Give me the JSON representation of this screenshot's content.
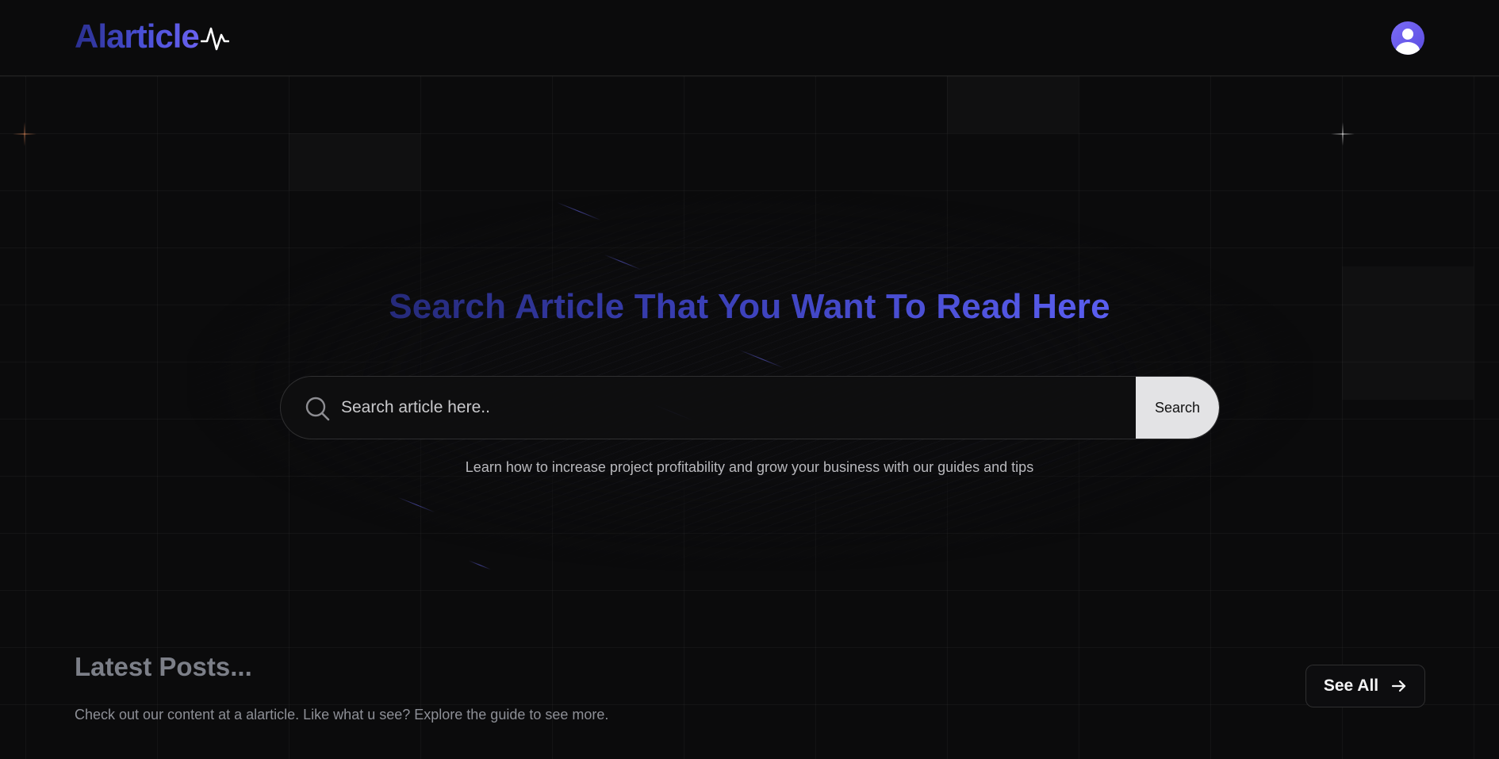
{
  "header": {
    "logo_text": "Alarticle",
    "logo_icon": "pulse-icon",
    "avatar_icon": "user-avatar-icon"
  },
  "hero": {
    "title": "Search Article That You Want To Read Here",
    "search": {
      "placeholder": "Search article here..",
      "value": "",
      "button_label": "Search",
      "icon": "search-icon"
    },
    "subtitle": "Learn how to increase project profitability and grow your business with our guides and tips"
  },
  "latest": {
    "title": "Latest Posts...",
    "description": "Check out our content at a alarticle. Like what u see? Explore the guide to see more.",
    "see_all_label": "See All",
    "see_all_icon": "arrow-right-icon"
  },
  "colors": {
    "background": "#0b0b0c",
    "accent_dark": "#252a7a",
    "accent_light": "#5a5ef0",
    "avatar": "#6b5cf0",
    "button_light": "#e3e3e5"
  }
}
